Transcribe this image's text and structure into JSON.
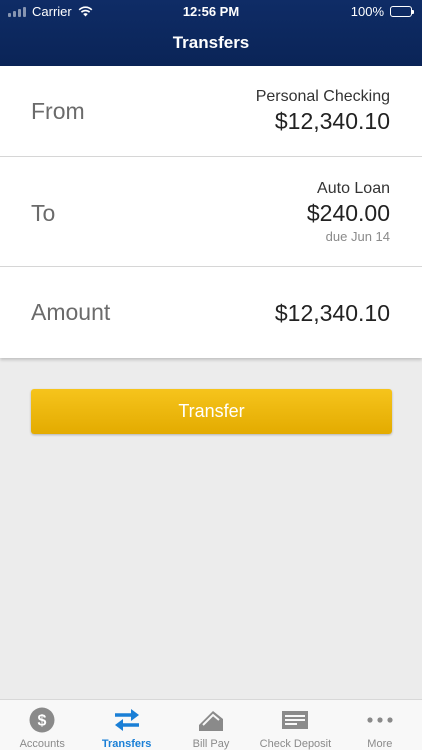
{
  "status_bar": {
    "carrier": "Carrier",
    "time": "12:56 PM",
    "battery": "100%"
  },
  "header": {
    "title": "Transfers"
  },
  "form": {
    "from": {
      "label": "From",
      "account": "Personal Checking",
      "amount": "$12,340.10"
    },
    "to": {
      "label": "To",
      "account": "Auto Loan",
      "amount": "$240.00",
      "due": "due Jun 14"
    },
    "amount": {
      "label": "Amount",
      "value": "$12,340.10"
    }
  },
  "actions": {
    "transfer_label": "Transfer"
  },
  "tabbar": {
    "items": [
      {
        "label": "Accounts",
        "icon": "dollar-coin-icon"
      },
      {
        "label": "Transfers",
        "icon": "transfer-arrows-icon",
        "active": true
      },
      {
        "label": "Bill Pay",
        "icon": "bill-pay-icon"
      },
      {
        "label": "Check Deposit",
        "icon": "check-icon"
      },
      {
        "label": "More",
        "icon": "more-dots-icon"
      }
    ]
  },
  "colors": {
    "header": "#0f2c66",
    "accent_button": "#f2b90f",
    "active_tab": "#1a7fd6"
  }
}
